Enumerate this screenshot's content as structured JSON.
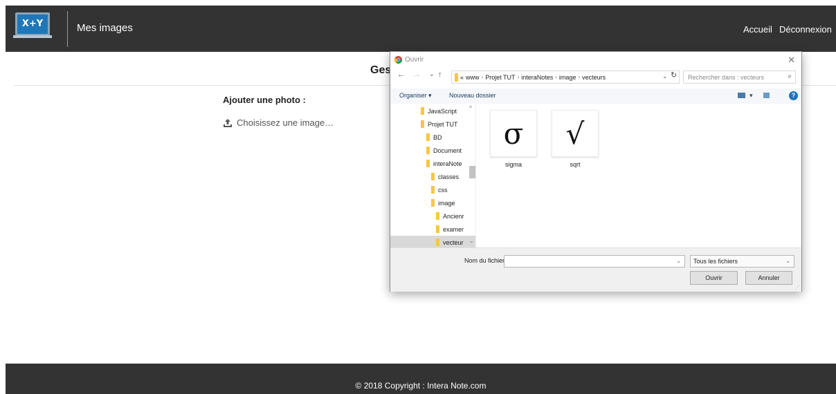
{
  "header": {
    "logo_text": "X+Y",
    "title": "Mes images",
    "nav": [
      {
        "label": "Accueil"
      },
      {
        "label": "Déconnexion"
      }
    ]
  },
  "main": {
    "heading": "Gest",
    "add_photo_label": "Ajouter une photo :",
    "upload_label": "Choisissez une image…"
  },
  "footer": {
    "text": "© 2018 Copyright : Intera Note.com"
  },
  "dialog": {
    "title": "Ouvrir",
    "close_glyph": "✕",
    "nav": {
      "back": "←",
      "forward": "→",
      "recent": "⌄",
      "up": "↑",
      "refresh": "↻",
      "dropdown": "⌄"
    },
    "breadcrumb": {
      "overflow": "«",
      "items": [
        "www",
        "Projet TUT",
        "interaNotes",
        "image",
        "vecteurs"
      ],
      "separator": "›"
    },
    "search_placeholder": "Rechercher dans : vecteurs",
    "search_glyph": "⌕",
    "toolbar": {
      "organize": "Organiser ▾",
      "new_folder": "Nouveau dossier",
      "view_caret": "▾",
      "help": "?"
    },
    "tree": [
      {
        "label": "JavaScript"
      },
      {
        "label": "Projet TUT"
      },
      {
        "label": "BD"
      },
      {
        "label": "Document"
      },
      {
        "label": "interaNote"
      },
      {
        "label": "classes"
      },
      {
        "label": "css"
      },
      {
        "label": "image"
      },
      {
        "label": "Ancienr"
      },
      {
        "label": "examer"
      },
      {
        "label": "vecteur",
        "selected": true
      }
    ],
    "tree_scroll": {
      "up": "^",
      "down": "⌄"
    },
    "files": [
      {
        "name": "sigma",
        "glyph": "σ"
      },
      {
        "name": "sqrt",
        "glyph": "√"
      }
    ],
    "filename_label": "Nom du fichier :",
    "filename_value": "",
    "filename_dropdown": "⌄",
    "filter_label": "Tous les fichiers",
    "filter_dropdown": "⌄",
    "open_label": "Ouvrir",
    "cancel_label": "Annuler",
    "resize_grip": "⋰"
  },
  "colors": {
    "bar": "#333333",
    "folder": "#f6c744",
    "help": "#1e73be"
  },
  "icons": [
    "upload-icon",
    "chrome-icon",
    "folder-icon",
    "search-icon",
    "help-icon",
    "view-icon",
    "preview-pane-icon"
  ]
}
